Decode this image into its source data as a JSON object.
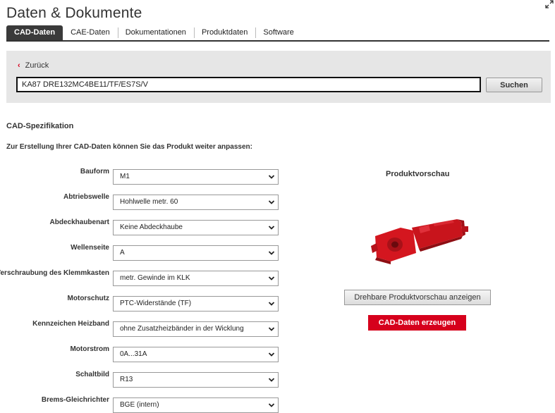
{
  "page": {
    "title": "Daten & Dokumente"
  },
  "tabs": [
    {
      "label": "CAD-Daten",
      "active": true
    },
    {
      "label": "CAE-Daten",
      "active": false
    },
    {
      "label": "Dokumentationen",
      "active": false
    },
    {
      "label": "Produktdaten",
      "active": false
    },
    {
      "label": "Software",
      "active": false
    }
  ],
  "search": {
    "back_label": "Zurück",
    "value": "KA87 DRE132MC4BE11/TF/ES7S/V",
    "button_label": "Suchen"
  },
  "spec": {
    "title": "CAD-Spezifikation",
    "intro": "Zur Erstellung Ihrer CAD-Daten können Sie das Produkt weiter anpassen:",
    "fields": [
      {
        "label": "Bauform",
        "value": "M1"
      },
      {
        "label": "Abtriebswelle",
        "value": "Hohlwelle metr. 60"
      },
      {
        "label": "Abdeckhaubenart",
        "value": "Keine Abdeckhaube"
      },
      {
        "label": "Wellenseite",
        "value": "A"
      },
      {
        "label": "Verschraubung des Klemmkasten",
        "value": "metr. Gewinde im KLK"
      },
      {
        "label": "Motorschutz",
        "value": "PTC-Widerstände (TF)"
      },
      {
        "label": "Kennzeichen Heizband",
        "value": "ohne Zusatzheizbänder in der Wicklung"
      },
      {
        "label": "Motorstrom",
        "value": "0A...31A"
      },
      {
        "label": "Schaltbild",
        "value": "R13"
      },
      {
        "label": "Brems-Gleichrichter",
        "value": "BGE (intern)"
      }
    ]
  },
  "preview": {
    "title": "Produktvorschau",
    "rotate_button": "Drehbare Produktvorschau anzeigen",
    "cad_button": "CAD-Daten erzeugen"
  },
  "colors": {
    "accent": "#d6001c",
    "panel": "#e6e6e6",
    "tab_active": "#3a3a3a"
  },
  "icons": {
    "expand": "expand-icon",
    "back": "chevron-left-icon",
    "select": "chevron-down-icon"
  }
}
